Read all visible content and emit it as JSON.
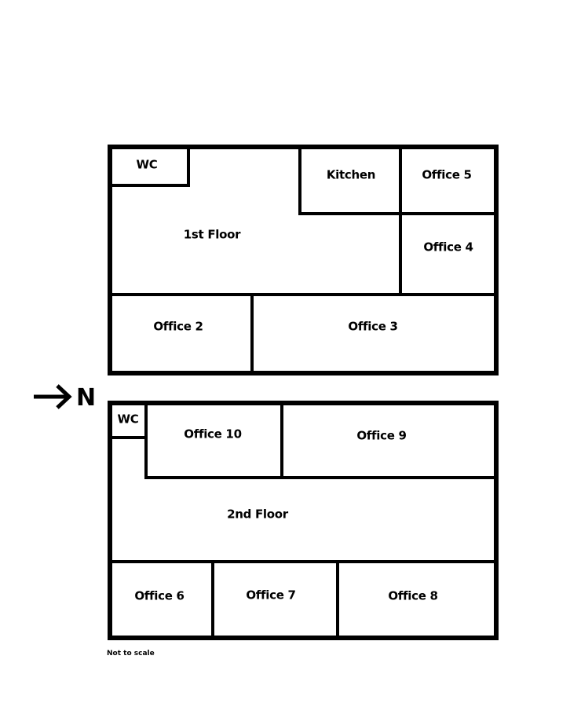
{
  "floor1": {
    "title": "1st Floor",
    "rooms": {
      "wc": "WC",
      "kitchen": "Kitchen",
      "office5": "Office 5",
      "office4": "Office 4",
      "office2": "Office 2",
      "office3": "Office 3"
    }
  },
  "floor2": {
    "title": "2nd Floor",
    "rooms": {
      "wc": "WC",
      "office10": "Office 10",
      "office9": "Office 9",
      "office6": "Office 6",
      "office7": "Office 7",
      "office8": "Office 8"
    }
  },
  "compass": {
    "label": "N",
    "icon": "arrow-right-icon"
  },
  "note": "Not to scale"
}
